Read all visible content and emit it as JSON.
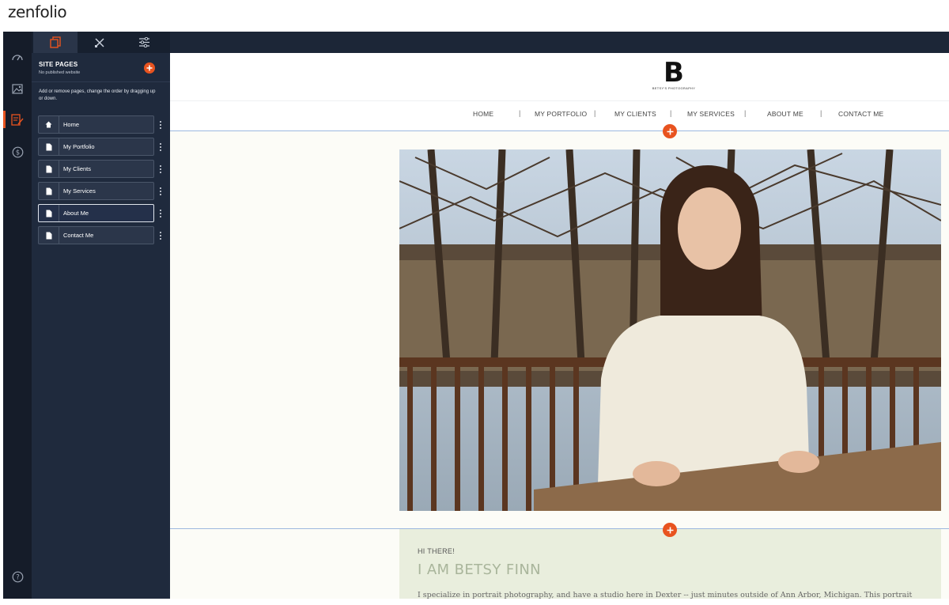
{
  "brand": {
    "logo_text": "zenfolio",
    "accent": "#e8531f"
  },
  "rail": {
    "icons": [
      "dashboard-icon",
      "gallery-icon",
      "site-pages-icon",
      "sell-icon",
      "help-icon"
    ],
    "active": "site-pages-icon"
  },
  "panel": {
    "tabs": [
      "pages-tab-icon",
      "design-tools-icon",
      "settings-sliders-icon"
    ],
    "title": "SITE PAGES",
    "subtitle": "No published website",
    "help_text": "Add or remove pages, change the order by dragging up or down.",
    "pages": [
      {
        "label": "Home",
        "icon": "home-icon"
      },
      {
        "label": "My Portfolio",
        "icon": "page-icon"
      },
      {
        "label": "My Clients",
        "icon": "page-icon"
      },
      {
        "label": "My Services",
        "icon": "page-icon"
      },
      {
        "label": "About Me",
        "icon": "page-icon",
        "selected": true
      },
      {
        "label": "Contact Me",
        "icon": "page-icon"
      }
    ]
  },
  "site": {
    "logo_letter": "B",
    "logo_sub": "BETSY'S PHOTOGRAPHY",
    "nav": [
      "HOME",
      "MY PORTFOLIO",
      "MY CLIENTS",
      "MY SERVICES",
      "ABOUT ME",
      "CONTACT ME"
    ],
    "nav_separator": "|",
    "about": {
      "greeting": "HI THERE!",
      "heading": "I AM BETSY FINN",
      "intro": "I specialize in portrait photography, and have a studio here in Dexter -- just minutes outside of Ann Arbor, Michigan.  This portrait"
    }
  }
}
